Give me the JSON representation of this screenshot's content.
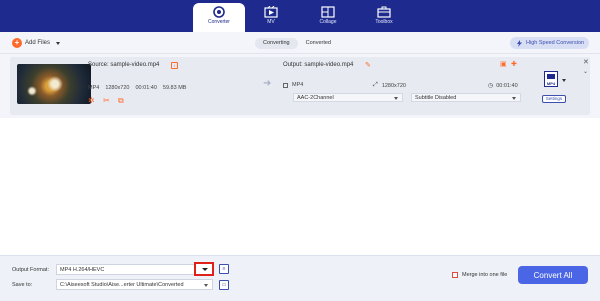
{
  "nav": {
    "tabs": [
      {
        "label": "Converter",
        "icon": "converter-icon",
        "active": true
      },
      {
        "label": "MV",
        "icon": "mv-icon",
        "active": false
      },
      {
        "label": "Collage",
        "icon": "collage-icon",
        "active": false
      },
      {
        "label": "Toolbox",
        "icon": "toolbox-icon",
        "active": false
      }
    ]
  },
  "toolbar": {
    "add_files_label": "Add Files",
    "segments": [
      "Converting",
      "Converted"
    ],
    "high_speed_label": "High Speed Conversion"
  },
  "file": {
    "source_label": "Source: sample-video.mp4",
    "format": "MP4",
    "resolution": "1280x720",
    "duration": "00:01:40",
    "size": "59.83 MB",
    "output_label": "Output: sample-video.mp4",
    "out_format": "MP4",
    "out_resolution": "1280x720",
    "out_duration": "00:01:40",
    "audio_track": "AAC-2Channel",
    "subtitle": "Subtitle Disabled",
    "format_icon_text": "MP4",
    "settings_label": "Settings"
  },
  "bottom": {
    "output_format_label": "Output Format:",
    "output_format_value": "MP4 H.264/HEVC",
    "save_to_label": "Save to:",
    "save_to_value": "C:\\Aiseesoft Studio\\Aise...erter Ultimate\\Converted",
    "merge_label": "Merge into one file",
    "convert_all_label": "Convert All"
  },
  "colors": {
    "brand_blue": "#1e2a8e",
    "accent_orange": "#ff6a2b",
    "convert_button": "#4a66e6",
    "highlight_red": "#e0201a"
  }
}
